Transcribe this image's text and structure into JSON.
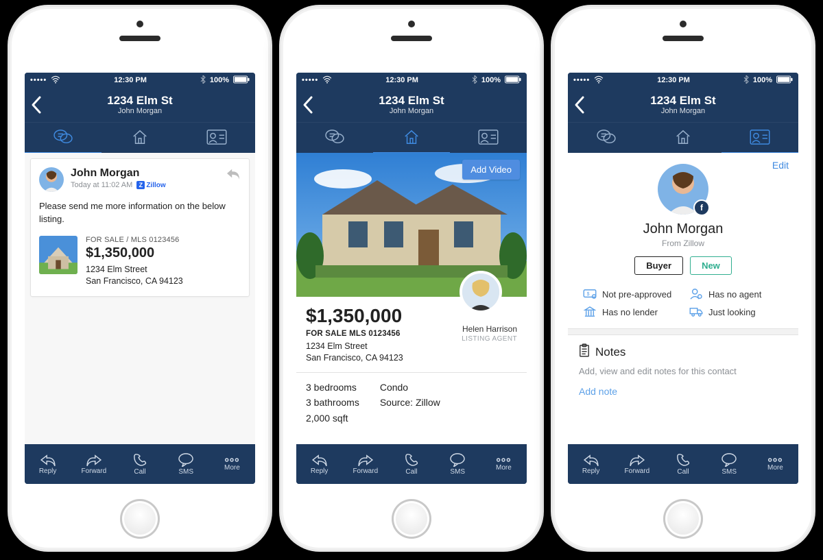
{
  "status": {
    "time": "12:30 PM",
    "battery": "100%"
  },
  "header": {
    "title": "1234 Elm St",
    "subtitle": "John Morgan"
  },
  "segtabs": {
    "chat_icon": "chat-icon",
    "home_icon": "home-icon",
    "contact_icon": "contact-card-icon"
  },
  "toolbar": {
    "reply": "Reply",
    "forward": "Forward",
    "call": "Call",
    "sms": "SMS",
    "more": "More"
  },
  "phone1": {
    "sender": "John Morgan",
    "timestamp": "Today at 11:02 AM",
    "source_badge": "Zillow",
    "body": "Please send me more information on the below listing.",
    "listing": {
      "sale_line": "FOR SALE / MLS 0123456",
      "price": "$1,350,000",
      "addr1": "1234 Elm Street",
      "addr2": "San Francisco, CA 94123"
    }
  },
  "phone2": {
    "add_video": "Add Video",
    "price": "$1,350,000",
    "sale_line": "FOR SALE  MLS 0123456",
    "addr1": "1234 Elm Street",
    "addr2": "San Francisco, CA 94123",
    "agent_name": "Helen Harrison",
    "agent_role": "LISTING AGENT",
    "specs_left": [
      "3 bedrooms",
      "3 bathrooms",
      "2,000 sqft"
    ],
    "specs_right": [
      "Condo",
      "Source: Zillow"
    ]
  },
  "phone3": {
    "edit": "Edit",
    "name": "John Morgan",
    "source": "From Zillow",
    "pill_buyer": "Buyer",
    "pill_new": "New",
    "status": {
      "preapproved": "Not pre-approved",
      "agent": "Has no agent",
      "lender": "Has no lender",
      "looking": "Just looking"
    },
    "notes_title": "Notes",
    "notes_sub": "Add, view and edit notes for this contact",
    "add_note": "Add note"
  }
}
